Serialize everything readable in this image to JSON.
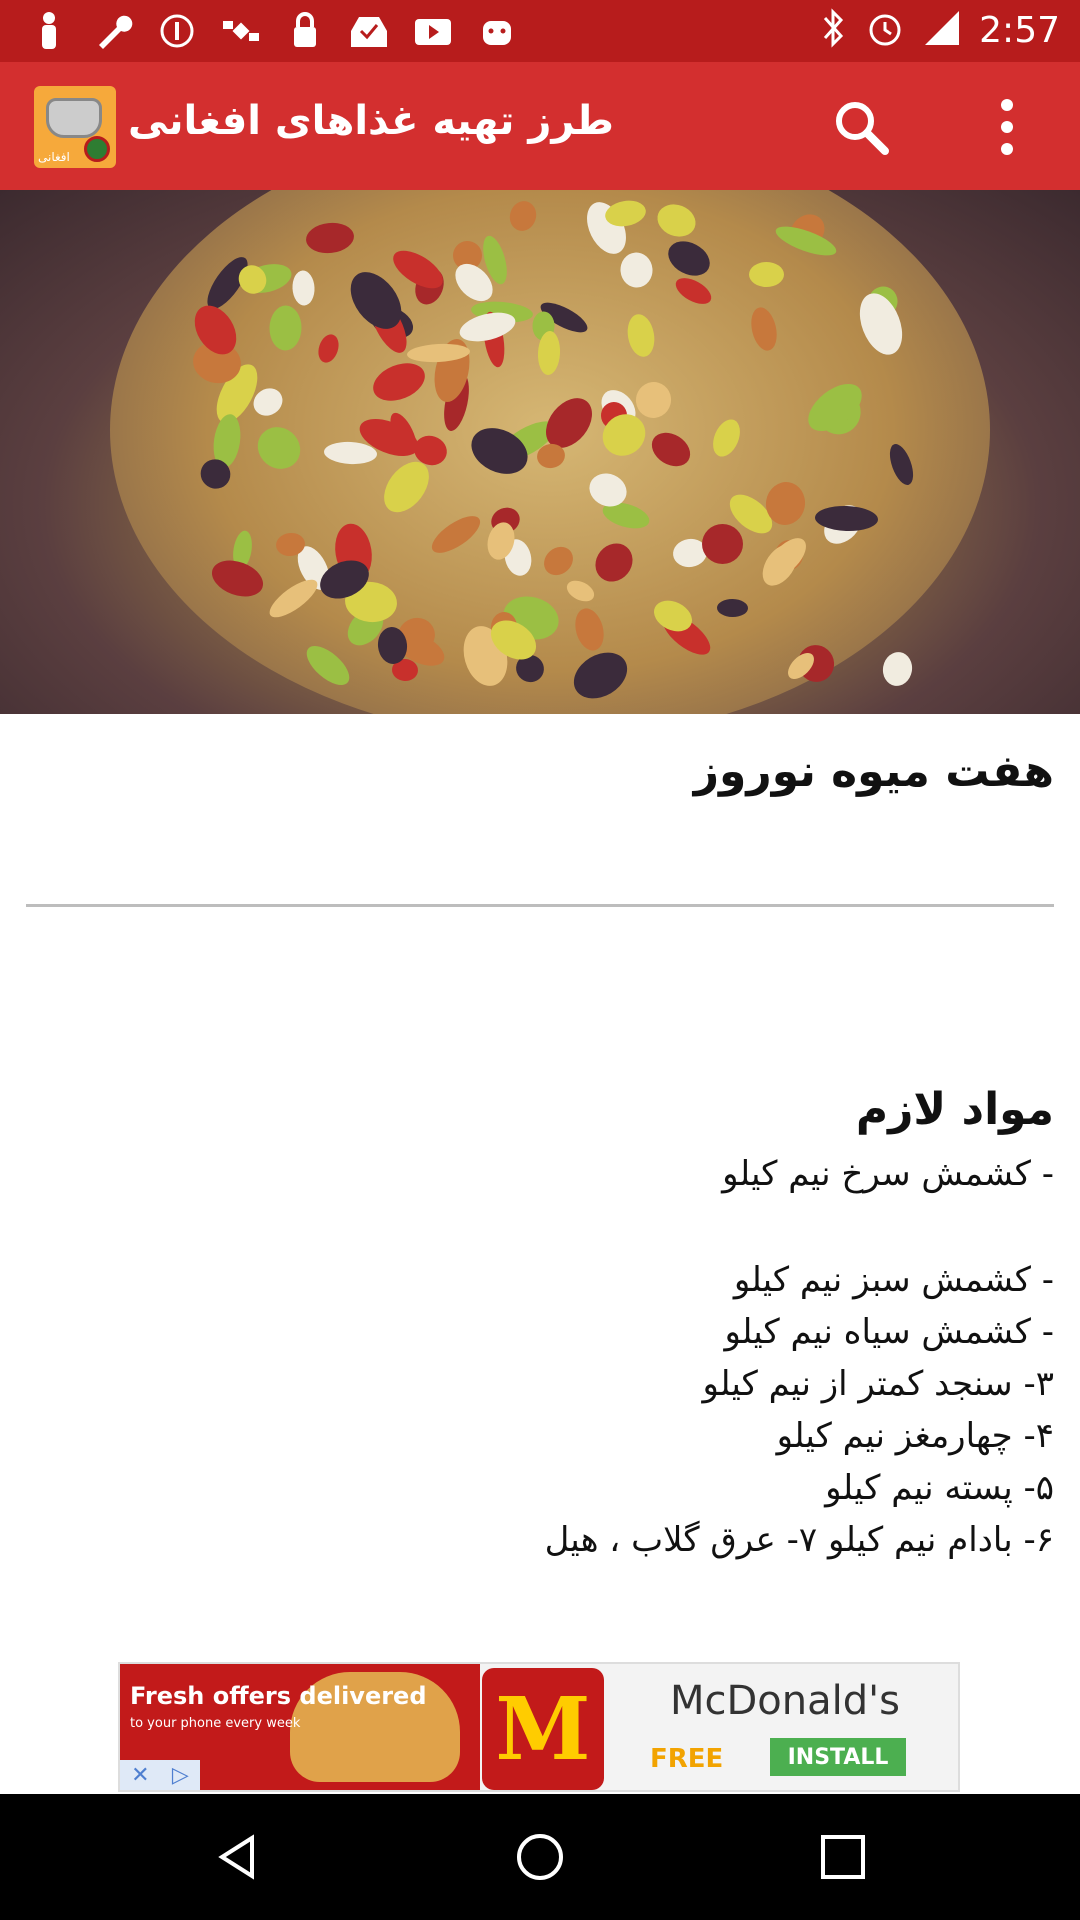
{
  "status_bar": {
    "time": "2:57",
    "left_icons": [
      "person-icon",
      "wrench-icon",
      "info-icon",
      "satellite-icon",
      "lock-icon",
      "inbox-icon",
      "video-icon",
      "android-icon"
    ],
    "right_icons": [
      "bluetooth-icon",
      "alarm-icon",
      "signal-icon"
    ]
  },
  "app_bar": {
    "title": "طرز تهیه غذاهای افغانی",
    "logo_label": "افغانی",
    "search_icon": "search-icon",
    "menu_icon": "more-vert-icon",
    "color": "#d32f2f"
  },
  "article": {
    "title": "هفت میوه نوروز",
    "ingredients_title": "مواد لازم",
    "ingredients": [
      "- کشمش سرخ نیم کیلو",
      "- کشمش سبز نیم کیلو",
      "- کشمش سیاه نیم کیلو",
      "۳- سنجد کمتر از نیم کیلو",
      "۴- چهارمغز نیم کیلو",
      "۵- پسته نیم کیلو",
      "۶- بادام نیم کیلو ۷- عرق گلاب ، هیل"
    ]
  },
  "ad": {
    "headline": "Fresh offers delivered",
    "subline": "to your phone every week",
    "brand": "McDonald's",
    "free_label": "FREE",
    "install_label": "INSTALL"
  },
  "nav": {
    "back_icon": "back-icon",
    "home_icon": "home-icon",
    "recents_icon": "recents-icon"
  }
}
